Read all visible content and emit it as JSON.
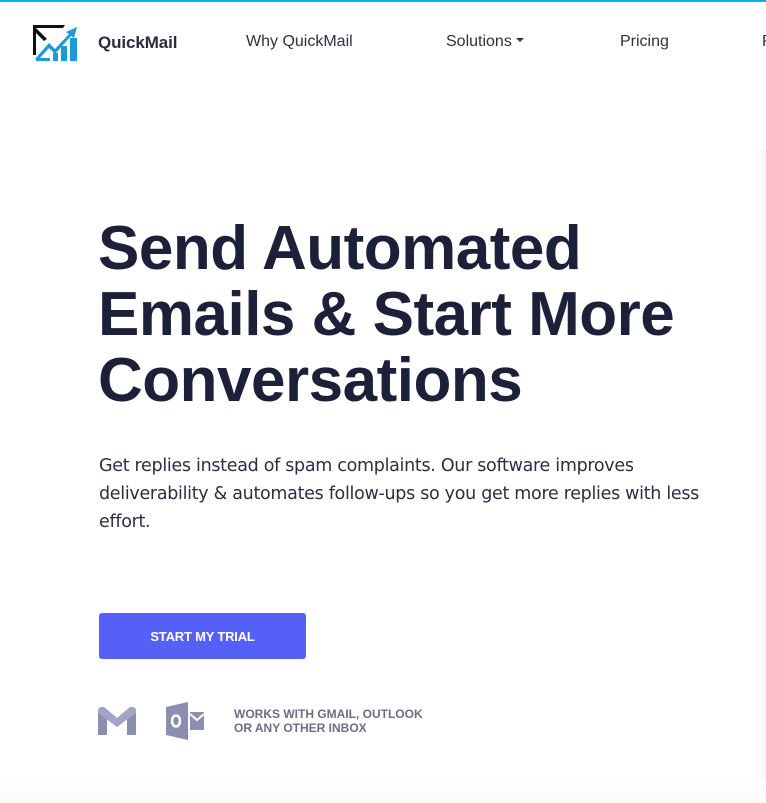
{
  "brand": {
    "name": "QuickMail",
    "colors": {
      "top_strip": "#00b2ee",
      "logo_blue": "#1a9bd7",
      "heading": "#1c2039",
      "cta": "#5460f6",
      "icon_gray": "#8c8eae"
    }
  },
  "nav": {
    "items": [
      {
        "label": "Why QuickMail"
      },
      {
        "label": "Solutions",
        "has_dropdown": true
      },
      {
        "label": "Pricing"
      },
      {
        "label": "R"
      }
    ]
  },
  "hero": {
    "title_lines": [
      "Send Automated",
      "Emails & Start More",
      "Conversations"
    ],
    "subtitle": "Get replies instead of spam complaints. Our software improves deliverability & automates follow-ups so you get more replies with less effort.",
    "cta_label": "START MY TRIAL",
    "compat_lines": [
      "WORKS WITH GMAIL, OUTLOOK",
      "OR ANY OTHER INBOX"
    ],
    "compat_icons": [
      "gmail-icon",
      "outlook-icon"
    ]
  }
}
